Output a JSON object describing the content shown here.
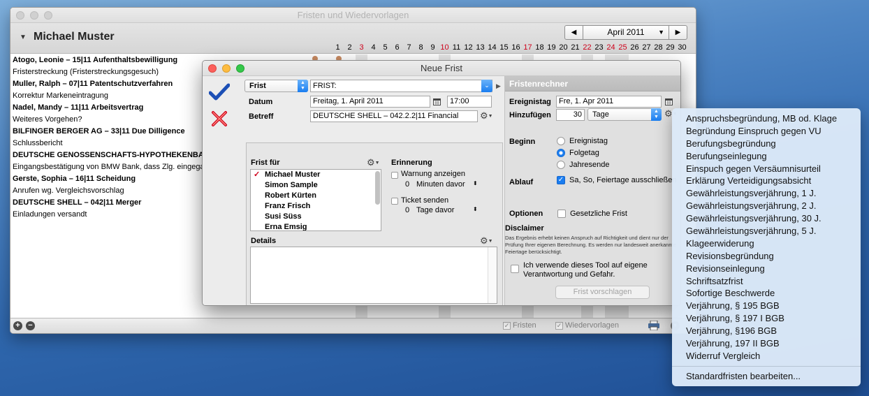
{
  "main_window": {
    "title": "Fristen und Wiedervorlagen",
    "person": "Michael Muster",
    "month": "April 2011",
    "days": [
      {
        "d": "1",
        "red": false
      },
      {
        "d": "2",
        "red": false
      },
      {
        "d": "3",
        "red": true
      },
      {
        "d": "4",
        "red": false
      },
      {
        "d": "5",
        "red": false
      },
      {
        "d": "6",
        "red": false
      },
      {
        "d": "7",
        "red": false
      },
      {
        "d": "8",
        "red": false
      },
      {
        "d": "9",
        "red": false
      },
      {
        "d": "10",
        "red": true
      },
      {
        "d": "11",
        "red": false
      },
      {
        "d": "12",
        "red": false
      },
      {
        "d": "13",
        "red": false
      },
      {
        "d": "14",
        "red": false
      },
      {
        "d": "15",
        "red": false
      },
      {
        "d": "16",
        "red": false
      },
      {
        "d": "17",
        "red": true
      },
      {
        "d": "18",
        "red": false
      },
      {
        "d": "19",
        "red": false
      },
      {
        "d": "20",
        "red": false
      },
      {
        "d": "21",
        "red": false
      },
      {
        "d": "22",
        "red": true
      },
      {
        "d": "23",
        "red": false
      },
      {
        "d": "24",
        "red": true
      },
      {
        "d": "25",
        "red": true
      },
      {
        "d": "26",
        "red": false
      },
      {
        "d": "27",
        "red": false
      },
      {
        "d": "28",
        "red": false
      },
      {
        "d": "29",
        "red": false
      },
      {
        "d": "30",
        "red": false
      }
    ],
    "cases": [
      {
        "text": "Atogo, Leonie – 15|11 Aufenthaltsbewilligung",
        "bold": true
      },
      {
        "text": "Fristerstreckung (Fristerstreckungsgesuch)",
        "bold": false
      },
      {
        "text": "Muller, Ralph – 07|11 Patentschutzverfahren",
        "bold": true
      },
      {
        "text": "Korrektur Markeneintragung",
        "bold": false
      },
      {
        "text": "Nadel, Mandy – 11|11 Arbeitsvertrag",
        "bold": true
      },
      {
        "text": "Weiteres Vorgehen?",
        "bold": false
      },
      {
        "text": "BILFINGER BERGER AG – 33|11 Due Dilligence",
        "bold": true
      },
      {
        "text": "Schlussbericht",
        "bold": false
      },
      {
        "text": "DEUTSCHE GENOSSENSCHAFTS-HYPOTHEKENBANK",
        "bold": true
      },
      {
        "text": "Eingangsbestätigung von BMW Bank, dass Zlg. eingega",
        "bold": false
      },
      {
        "text": "Gerste, Sophia – 16|11 Scheidung",
        "bold": true
      },
      {
        "text": "Anrufen wg. Vergleichsvorschlag",
        "bold": false
      },
      {
        "text": "DEUTSCHE SHELL – 042|11 Merger",
        "bold": true
      },
      {
        "text": "Einladungen versandt",
        "bold": false
      }
    ],
    "footer": {
      "fristen_label": "Fristen",
      "wiedervorlagen_label": "Wiedervorlagen"
    }
  },
  "dialog": {
    "title": "Neue Frist",
    "type_popup": "Frist",
    "frist_field": "FRIST:",
    "datum_label": "Datum",
    "datum_value": "Freitag, 1. April 2011",
    "time_value": "17:00",
    "betreff_label": "Betreff",
    "betreff_value": "DEUTSCHE SHELL – 042.2.2|11 Financial",
    "frist_fuer_label": "Frist für",
    "people": [
      "Michael Muster",
      "Simon Sample",
      "Robert Kürten",
      "Franz Frisch",
      "Susi Süss",
      "Erna Emsig"
    ],
    "erinnerung_label": "Erinnerung",
    "warnung_label": "Warnung anzeigen",
    "warnung_count": "0",
    "warnung_unit": "Minuten davor",
    "ticket_label": "Ticket senden",
    "ticket_count": "0",
    "ticket_unit": "Tage davor",
    "details_label": "Details"
  },
  "rechner": {
    "title": "Fristenrechner",
    "ereignistag_label": "Ereignistag",
    "ereignistag_value": "Fre, 1. Apr 2011",
    "hinzufuegen_label": "Hinzufügen",
    "hinzufuegen_value": "30",
    "unit_popup": "Tage",
    "beginn_label": "Beginn",
    "beginn_options": [
      "Ereignistag",
      "Folgetag",
      "Jahresende"
    ],
    "ablauf_label": "Ablauf",
    "ablauf_option": "Sa, So, Feiertage ausschließen",
    "optionen_label": "Optionen",
    "gesetzliche_label": "Gesetzliche Frist",
    "disclaimer_title": "Disclaimer",
    "disclaimer_text": "Das Ergebnis erhebt keinen Anspruch auf Richtigkeit und dient nur der Prüfung Ihrer eigenen Berechnung. Es werden nur landesweit anerkannte Feiertage berücksichtigt.",
    "tool_check_label": "Ich verwende dieses Tool auf eigene Verantwortung und Gefahr.",
    "suggest_button": "Frist vorschlagen"
  },
  "menu": {
    "items": [
      "Anspruchsbegründung, MB od. Klage",
      "Begründung Einspruch gegen VU",
      "Berufungsbegründung",
      "Berufungseinlegung",
      "Einspuch gegen Versäumnisurteil",
      "Erklärung Verteidigungsabsicht",
      "Gewährleistungsverjährung, 1 J.",
      "Gewährleistungsverjährung, 2 J.",
      "Gewährleistungsverjährung, 30 J.",
      "Gewährleistungsverjährung, 5 J.",
      "Klageerwiderung",
      "Revisionsbegründung",
      "Revisionseinlegung",
      "Schriftsatzfrist",
      "Sofortige Beschwerde",
      "Verjährung, § 195 BGB",
      "Verjährung, § 197 I BGB",
      "Verjährung, §196 BGB",
      "Verjährung, 197 II BGB",
      "Widerruf Vergleich"
    ],
    "edit_item": "Standardfristen bearbeiten..."
  },
  "colors": {
    "accent": "#1a7df0",
    "weekend_red": "#d0021b",
    "menu_bg": "#dce9f8"
  }
}
